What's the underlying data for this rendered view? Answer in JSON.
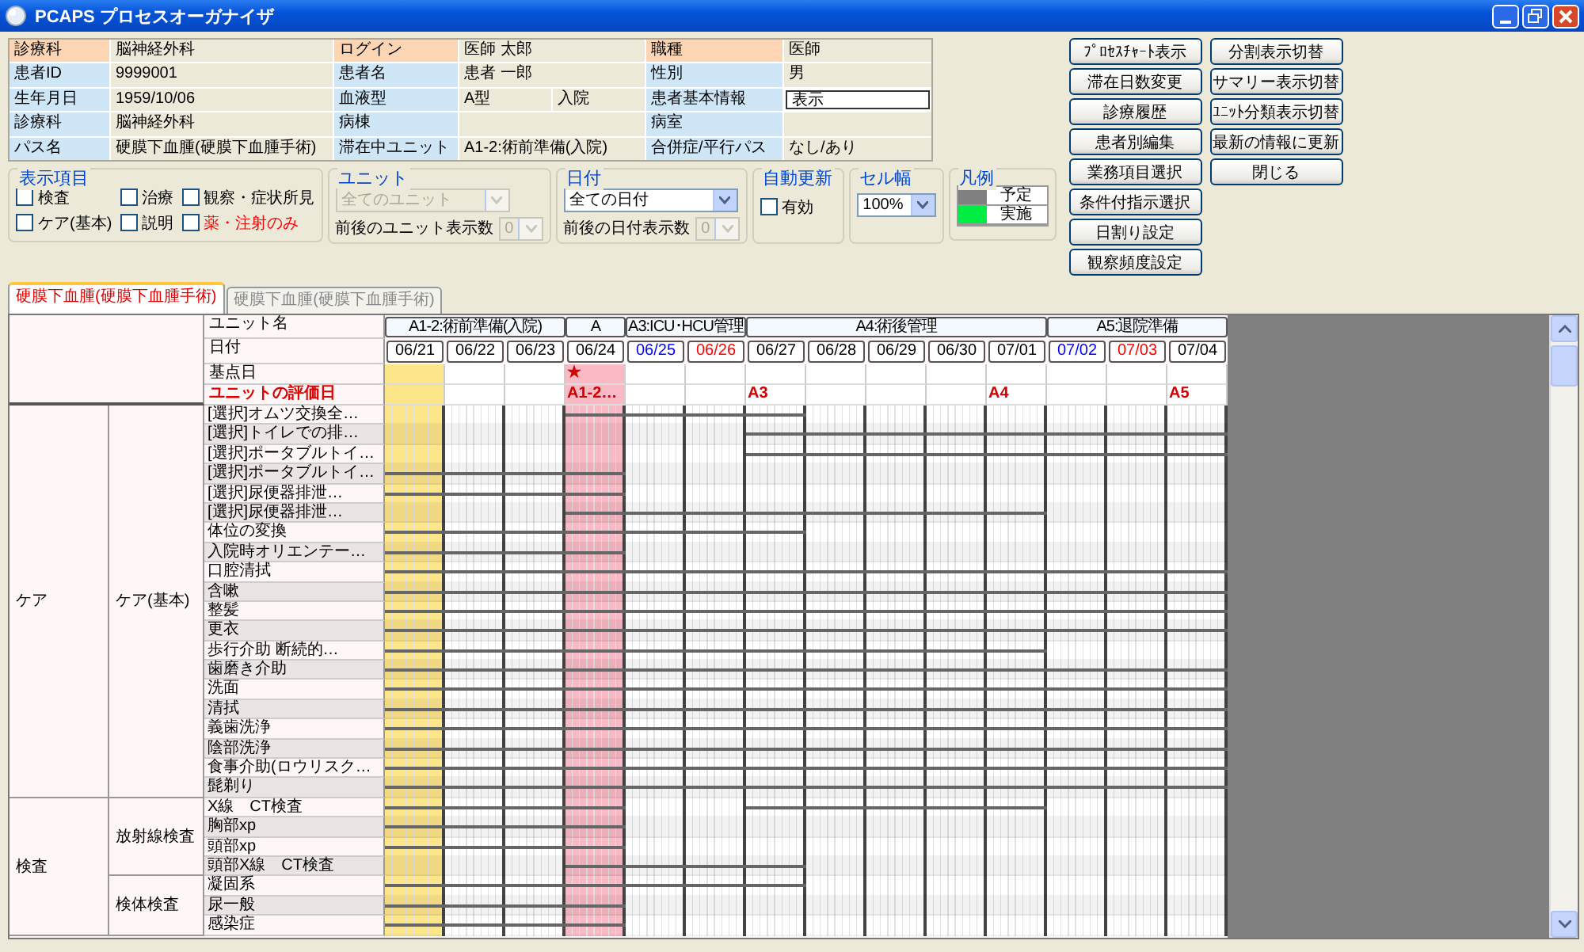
{
  "window": {
    "title": "PCAPS プロセスオーガナイザ"
  },
  "patient_info": {
    "rows": [
      {
        "cells": [
          {
            "label": "診療科",
            "color": "#fcd5b4",
            "value": "脳神経外科",
            "kind": "text"
          },
          {
            "label": "ログイン",
            "color": "#fcd5b4",
            "value": "医師 太郎",
            "kind": "text"
          },
          {
            "label": "職種",
            "color": "#fcd5b4",
            "value": "医師",
            "kind": "text"
          }
        ]
      },
      {
        "cells": [
          {
            "label": "患者ID",
            "color": "#cfe6f7",
            "value": "9999001",
            "kind": "text"
          },
          {
            "label": "患者名",
            "color": "#cfe6f7",
            "value": "患者 一郎",
            "kind": "text"
          },
          {
            "label": "性別",
            "color": "#cfe6f7",
            "value": "男",
            "kind": "text"
          }
        ]
      },
      {
        "cells": [
          {
            "label": "生年月日",
            "color": "#cfe6f7",
            "value": "1959/10/06",
            "kind": "text"
          },
          {
            "label": "血液型",
            "color": "#cfe6f7",
            "value": "A型",
            "extra": "入院",
            "kind": "text"
          },
          {
            "label": "患者基本情報",
            "color": "#cfe6f7",
            "value": "表示",
            "kind": "field"
          }
        ]
      },
      {
        "cells": [
          {
            "label": "診療科",
            "color": "#cfe6f7",
            "value": "脳神経外科",
            "kind": "text"
          },
          {
            "label": "病棟",
            "color": "#cfe6f7"
          },
          {
            "label": "病室",
            "color": "#cfe6f7"
          }
        ]
      },
      {
        "cells": [
          {
            "label": "パス名",
            "color": "#cfe6f7",
            "value": "硬膜下血腫(硬膜下血腫手術)",
            "kind": "text"
          },
          {
            "label": "滞在中ユニット",
            "color": "#cfe6f7",
            "value": "A1-2:術前準備(入院)",
            "kind": "text"
          },
          {
            "label": "合併症/平行パス",
            "color": "#cfe6f7",
            "value": "なし/あり",
            "kind": "text"
          }
        ]
      }
    ]
  },
  "display_items": {
    "title": "表示項目",
    "items": [
      {
        "label": "検査",
        "checked": false,
        "color": "#000000"
      },
      {
        "label": "治療",
        "checked": false,
        "color": "#000000"
      },
      {
        "label": "観察・症状所見",
        "checked": false,
        "color": "#000000"
      },
      {
        "label": "ケア(基本)",
        "checked": false,
        "color": "#000000"
      },
      {
        "label": "説明",
        "checked": false,
        "color": "#000000"
      },
      {
        "label": "薬・注射のみ",
        "checked": false,
        "color": "#ff0000"
      }
    ]
  },
  "unit_filter": {
    "title": "ユニット",
    "select": {
      "value": "全てのユニット",
      "disabled": true
    },
    "range_label": "前後のユニット表示数",
    "range_select": {
      "value": "0",
      "disabled": true
    }
  },
  "date_filter": {
    "title": "日付",
    "select": {
      "value": "全ての日付",
      "disabled": false
    },
    "range_label": "前後の日付表示数",
    "range_select": {
      "value": "0",
      "disabled": true
    }
  },
  "auto_update": {
    "title": "自動更新",
    "label": "有効",
    "checked": false
  },
  "cell_width": {
    "title": "セル幅",
    "select": {
      "value": "100%",
      "disabled": false
    }
  },
  "legend": {
    "title": "凡例",
    "items": [
      {
        "label": "予定",
        "color": "#808080"
      },
      {
        "label": "実施",
        "color": "#00ee44"
      }
    ]
  },
  "buttons": {
    "column_1": [
      "ﾌﾟﾛｾｽﾁｬｰﾄ表示",
      "滞在日数変更",
      "診療履歴",
      "患者別編集",
      "業務項目選択",
      "条件付指示選択",
      "日割り設定",
      "観察頻度設定"
    ],
    "column_2": [
      "分割表示切替",
      "サマリー表示切替",
      "ﾕﾆｯﾄ分類表示切替",
      "最新の情報に更新",
      "閉じる"
    ]
  },
  "tabs": [
    {
      "label": "硬膜下血腫(硬膜下血腫手術)",
      "selected": true
    },
    {
      "label": "硬膜下血腫(硬膜下血腫手術)",
      "selected": false
    }
  ],
  "grid": {
    "header_labels": {
      "unit": "ユニット名",
      "date": "日付",
      "base": "基点日",
      "evaluation": "ユニットの評価日"
    },
    "units": [
      {
        "name": "A1-2:術前準備(入院)",
        "dates": [
          {
            "date": "06/21",
            "color": "#000000",
            "today": true,
            "base": false
          },
          {
            "date": "06/22",
            "color": "#000000",
            "today": false,
            "base": false
          },
          {
            "date": "06/23",
            "color": "#000000",
            "today": false,
            "base": false
          }
        ]
      },
      {
        "name": "A",
        "dates": [
          {
            "date": "06/24",
            "color": "#000000",
            "today": false,
            "base": true,
            "base_mark": "★",
            "evaluation": "A1-2…"
          }
        ]
      },
      {
        "name": "A3:ICU･HCU管理",
        "dates": [
          {
            "date": "06/25",
            "color": "#0000ff",
            "today": false,
            "base": false
          },
          {
            "date": "06/26",
            "color": "#ff0000",
            "today": false,
            "base": false
          }
        ]
      },
      {
        "name": "A4:術後管理",
        "dates": [
          {
            "date": "06/27",
            "color": "#000000",
            "today": false,
            "base": false,
            "evaluation": "A3"
          },
          {
            "date": "06/28",
            "color": "#000000",
            "today": false,
            "base": false
          },
          {
            "date": "06/29",
            "color": "#000000",
            "today": false,
            "base": false
          },
          {
            "date": "06/30",
            "color": "#000000",
            "today": false,
            "base": false
          },
          {
            "date": "07/01",
            "color": "#000000",
            "today": false,
            "base": false,
            "evaluation": "A4"
          }
        ]
      },
      {
        "name": "A5:退院準備",
        "dates": [
          {
            "date": "07/02",
            "color": "#0000ff",
            "today": false,
            "base": false
          },
          {
            "date": "07/03",
            "color": "#ff0000",
            "today": false,
            "base": false
          },
          {
            "date": "07/04",
            "color": "#000000",
            "today": false,
            "base": false,
            "evaluation": "A5"
          }
        ]
      }
    ],
    "groups": [
      {
        "name": "ケア",
        "children": [
          {
            "name": "ケア(基本)",
            "children": [
              {
                "name": "[選択]オムツ交換全…",
                "plan": [
                  false,
                  false,
                  false,
                  true,
                  true,
                  true,
                  true,
                  false,
                  false,
                  false,
                  false,
                  false,
                  false,
                  false
                ]
              },
              {
                "name": "[選択]トイレでの排…",
                "plan": [
                  false,
                  false,
                  false,
                  false,
                  false,
                  false,
                  true,
                  true,
                  true,
                  true,
                  true,
                  true,
                  true,
                  true
                ]
              },
              {
                "name": "[選択]ポータブルトイ…",
                "plan": [
                  false,
                  false,
                  false,
                  false,
                  false,
                  false,
                  true,
                  true,
                  true,
                  true,
                  true,
                  true,
                  true,
                  true
                ]
              },
              {
                "name": "[選択]ポータブルトイ…",
                "plan": [
                  true,
                  true,
                  true,
                  true,
                  false,
                  false,
                  false,
                  false,
                  false,
                  false,
                  false,
                  false,
                  false,
                  false
                ]
              },
              {
                "name": "[選択]尿便器排泄…",
                "plan": [
                  true,
                  true,
                  true,
                  true,
                  false,
                  false,
                  false,
                  false,
                  false,
                  false,
                  false,
                  false,
                  false,
                  false
                ]
              },
              {
                "name": "[選択]尿便器排泄…",
                "plan": [
                  false,
                  false,
                  false,
                  true,
                  true,
                  true,
                  true,
                  true,
                  true,
                  true,
                  true,
                  false,
                  false,
                  false
                ]
              },
              {
                "name": "体位の変換",
                "plan": [
                  true,
                  true,
                  true,
                  true,
                  true,
                  true,
                  true,
                  false,
                  false,
                  false,
                  false,
                  false,
                  false,
                  false
                ]
              },
              {
                "name": "入院時オリエンテー…",
                "plan": [
                  true,
                  true,
                  true,
                  true,
                  false,
                  false,
                  false,
                  false,
                  false,
                  false,
                  false,
                  false,
                  false,
                  false
                ]
              },
              {
                "name": "口腔清拭",
                "plan": [
                  true,
                  true,
                  true,
                  true,
                  true,
                  true,
                  true,
                  true,
                  true,
                  true,
                  true,
                  true,
                  true,
                  true
                ]
              },
              {
                "name": "含嗽",
                "plan": [
                  true,
                  true,
                  true,
                  true,
                  true,
                  true,
                  true,
                  true,
                  true,
                  true,
                  true,
                  true,
                  true,
                  true
                ]
              },
              {
                "name": "整髪",
                "plan": [
                  true,
                  true,
                  true,
                  true,
                  true,
                  true,
                  true,
                  true,
                  true,
                  true,
                  true,
                  true,
                  true,
                  true
                ]
              },
              {
                "name": "更衣",
                "plan": [
                  true,
                  true,
                  true,
                  true,
                  true,
                  true,
                  true,
                  true,
                  true,
                  true,
                  true,
                  true,
                  true,
                  true
                ]
              },
              {
                "name": "歩行介助 断続的…",
                "plan": [
                  true,
                  true,
                  true,
                  true,
                  true,
                  true,
                  true,
                  true,
                  true,
                  true,
                  true,
                  false,
                  false,
                  false
                ]
              },
              {
                "name": "歯磨き介助",
                "plan": [
                  true,
                  true,
                  true,
                  true,
                  true,
                  true,
                  true,
                  true,
                  true,
                  true,
                  true,
                  true,
                  true,
                  true
                ]
              },
              {
                "name": "洗面",
                "plan": [
                  true,
                  true,
                  true,
                  true,
                  true,
                  true,
                  true,
                  true,
                  true,
                  true,
                  true,
                  true,
                  true,
                  true
                ]
              },
              {
                "name": "清拭",
                "plan": [
                  true,
                  true,
                  true,
                  true,
                  true,
                  true,
                  true,
                  true,
                  true,
                  true,
                  true,
                  true,
                  true,
                  true
                ]
              },
              {
                "name": "義歯洗浄",
                "plan": [
                  true,
                  true,
                  true,
                  true,
                  true,
                  true,
                  true,
                  true,
                  true,
                  true,
                  true,
                  true,
                  true,
                  true
                ]
              },
              {
                "name": "陰部洗浄",
                "plan": [
                  true,
                  true,
                  true,
                  true,
                  true,
                  true,
                  true,
                  true,
                  true,
                  true,
                  true,
                  true,
                  true,
                  true
                ]
              },
              {
                "name": "食事介助(ロウリスク…",
                "plan": [
                  true,
                  true,
                  true,
                  true,
                  true,
                  true,
                  true,
                  true,
                  true,
                  true,
                  true,
                  true,
                  true,
                  true
                ]
              },
              {
                "name": "髭剃り",
                "plan": [
                  true,
                  true,
                  true,
                  true,
                  true,
                  true,
                  true,
                  true,
                  true,
                  true,
                  true,
                  true,
                  true,
                  true
                ]
              }
            ]
          }
        ]
      },
      {
        "name": "検査",
        "children": [
          {
            "name": "放射線検査",
            "children": [
              {
                "name": "X線　CT検査",
                "plan": [
                  true,
                  true,
                  true,
                  true,
                  false,
                  false,
                  true,
                  true,
                  true,
                  true,
                  true,
                  false,
                  false,
                  false
                ]
              },
              {
                "name": "胸部xp",
                "plan": [
                  true,
                  true,
                  true,
                  true,
                  false,
                  false,
                  false,
                  false,
                  false,
                  false,
                  false,
                  false,
                  false,
                  false
                ]
              },
              {
                "name": "頭部xp",
                "plan": [
                  true,
                  true,
                  true,
                  true,
                  false,
                  false,
                  false,
                  false,
                  false,
                  false,
                  false,
                  false,
                  false,
                  false
                ]
              },
              {
                "name": "頭部X線　CT検査",
                "plan": [
                  false,
                  false,
                  false,
                  true,
                  true,
                  true,
                  true,
                  false,
                  false,
                  false,
                  false,
                  false,
                  false,
                  false
                ]
              }
            ]
          },
          {
            "name": "検体検査",
            "children": [
              {
                "name": "凝固系",
                "plan": [
                  true,
                  true,
                  true,
                  true,
                  true,
                  true,
                  true,
                  false,
                  false,
                  false,
                  false,
                  false,
                  false,
                  false
                ]
              },
              {
                "name": "尿一般",
                "plan": [
                  true,
                  true,
                  true,
                  true,
                  false,
                  false,
                  false,
                  false,
                  false,
                  false,
                  false,
                  false,
                  false,
                  false
                ]
              },
              {
                "name": "感染症",
                "plan": [
                  true,
                  true,
                  true,
                  true,
                  false,
                  false,
                  false,
                  false,
                  false,
                  false,
                  false,
                  false,
                  false,
                  false
                ]
              }
            ]
          }
        ]
      }
    ]
  }
}
